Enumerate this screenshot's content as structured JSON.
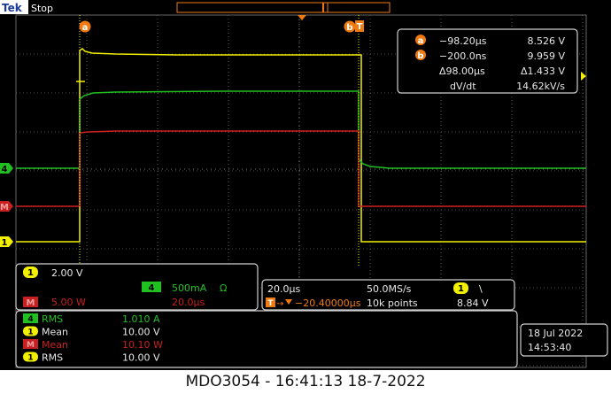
{
  "header": {
    "brand": "Tek",
    "run_state": "Stop",
    "trigger_marker": "T"
  },
  "cursors": {
    "a_label": "a",
    "b_label": "b",
    "a_time": "−98.20μs",
    "a_value": "8.526 V",
    "b_time": "−200.0ns",
    "b_value": "9.959 V",
    "delta_time": "Δ98.00μs",
    "delta_value": "Δ1.433 V",
    "dvdt_label": "dV/dt",
    "dvdt_value": "14.62kV/s"
  },
  "channel_markers": {
    "ch4": "4",
    "math": "M",
    "ch1": "1"
  },
  "channel_panel": {
    "ch1_badge": "1",
    "ch1_scale": "2.00 V",
    "ch4_badge": "4",
    "ch4_scale": "500mA",
    "ch4_unit": "Ω",
    "math_badge": "M",
    "math_scale": "5.00 W",
    "math_time": "20.0μs"
  },
  "timebase": {
    "horizontal_scale": "20.0μs",
    "sample_rate": "50.0MS/s",
    "trigger_channel": "1",
    "trigger_slope": "\\",
    "trigger_badge": "T",
    "trigger_position": "−20.40000μs",
    "record_length": "10k points",
    "trigger_level": "8.84 V"
  },
  "measurements": [
    {
      "badge": "4",
      "name": "RMS",
      "value": "1.010 A",
      "color": "#20c020"
    },
    {
      "badge": "1",
      "name": "Mean",
      "value": "10.00 V",
      "color": "#f0f000"
    },
    {
      "badge": "M",
      "name": "Mean",
      "value": "10.10 W",
      "color": "#c82020"
    },
    {
      "badge": "1",
      "name": "RMS",
      "value": "10.00 V",
      "color": "#f0f000"
    }
  ],
  "datetime": {
    "date": "18 Jul  2022",
    "time": "14:53:40"
  },
  "caption": "MDO3054 - 16:41:13   18-7-2022",
  "colors": {
    "ch1_yellow": "#f2f000",
    "ch4_green": "#20c020",
    "math_red": "#d02020",
    "cursor_orange": "#f07a10",
    "grid": "#5a5a5a",
    "brand_blue": "#1a3a9a"
  }
}
